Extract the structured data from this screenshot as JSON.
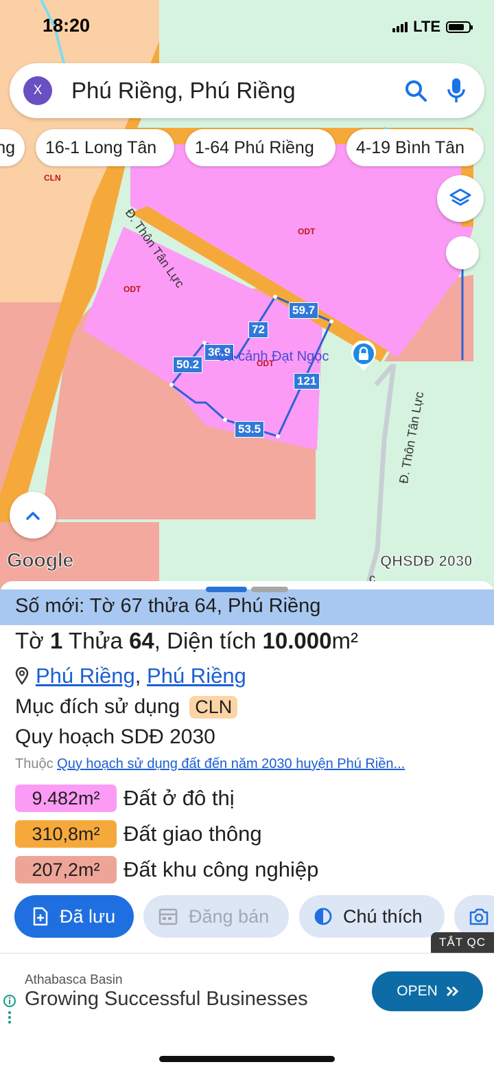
{
  "status": {
    "time": "18:20",
    "network": "LTE"
  },
  "search": {
    "avatar_letter": "X",
    "text": "Phú Riềng, Phú Riềng"
  },
  "chips": [
    "ng",
    "16-1 Long Tân",
    "1-64 Phú Riềng",
    "4-19 Bình Tân"
  ],
  "map": {
    "zone_labels": {
      "cln": "CLN",
      "odt_top": "ODT",
      "odt_left": "ODT",
      "odt_center": "ODT"
    },
    "roads": {
      "road_left": "Đ. Thôn Tân Lực",
      "road_right": "Đ. Thôn Tân Lực",
      "road_bottom": "c"
    },
    "segments": {
      "s1": "59.7",
      "s2": "72",
      "s3": "36.9",
      "s4": "50.2",
      "s5": "121",
      "s6": "53.5"
    },
    "poi": "Cá cảnh Đạt Ngọc",
    "google_logo": "Google",
    "layer_name": "QHSDĐ 2030",
    "colors": {
      "odt": "#fc9bf5",
      "road": "#f6a93b",
      "cln": "#fcd0a5",
      "skn": "#f3a99e",
      "green": "#d6f3e0",
      "parcel": "#2c62d6"
    }
  },
  "sheet": {
    "new_number": "Số mới: Tờ 67 thửa 64, Phú Riềng",
    "info": {
      "to_label": "Tờ",
      "to_value": "1",
      "thua_label": "Thửa",
      "thua_value": "64",
      "dt_label": ", Diện tích",
      "dt_value": "10.000",
      "unit": "m²"
    },
    "loc1": "Phú Riềng",
    "loc_sep": ",",
    "loc2": "Phú Riềng",
    "purpose_label": "Mục đích sử dụng",
    "purpose_badge": "CLN",
    "plan": "Quy hoạch SDĐ 2030",
    "belong_label": "Thuộc",
    "belong_link": "Quy hoạch sử dụng đất đến năm 2030 huyện Phú Riền...",
    "areas": [
      {
        "value": "9.482m²",
        "label": "Đất ở đô thị",
        "color": "#fc9bf5"
      },
      {
        "value": "310,8m²",
        "label": "Đất giao thông",
        "color": "#f6a93b"
      },
      {
        "value": "207,2m²",
        "label": "Đất khu công nghiệp",
        "color": "#eea598"
      }
    ],
    "actions": {
      "saved": "Đã lưu",
      "sell": "Đăng bán",
      "legend": "Chú thích"
    }
  },
  "ad": {
    "close_label": "TẮT QC",
    "advertiser": "Athabasca Basin",
    "headline": "Growing Successful Businesses",
    "cta": "OPEN"
  }
}
